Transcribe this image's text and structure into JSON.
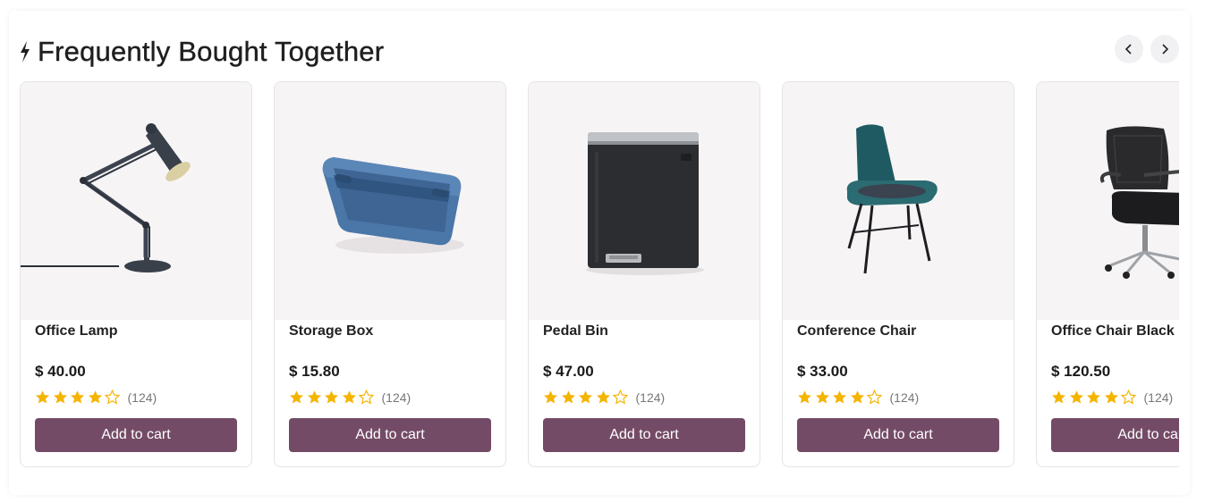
{
  "section": {
    "title": "Frequently Bought Together",
    "accent": "#744b66",
    "star_color": "#f5b400",
    "title_icon": "lightning-bolt-icon",
    "prev_icon": "chevron-left-icon",
    "next_icon": "chevron-right-icon"
  },
  "products": [
    {
      "name": "Office Lamp",
      "price": "$ 40.00",
      "rating": 4,
      "reviews": "(124)",
      "button": "Add to cart",
      "image": "desk-lamp"
    },
    {
      "name": "Storage Box",
      "price": "$ 15.80",
      "rating": 4,
      "reviews": "(124)",
      "button": "Add to cart",
      "image": "storage-box"
    },
    {
      "name": "Pedal Bin",
      "price": "$ 47.00",
      "rating": 4,
      "reviews": "(124)",
      "button": "Add to cart",
      "image": "pedal-bin"
    },
    {
      "name": "Conference Chair",
      "price": "$ 33.00",
      "rating": 4,
      "reviews": "(124)",
      "button": "Add to cart",
      "image": "conference-chair"
    },
    {
      "name": "Office Chair Black",
      "price": "$ 120.50",
      "rating": 4,
      "reviews": "(124)",
      "button": "Add to cart",
      "image": "office-chair"
    }
  ]
}
